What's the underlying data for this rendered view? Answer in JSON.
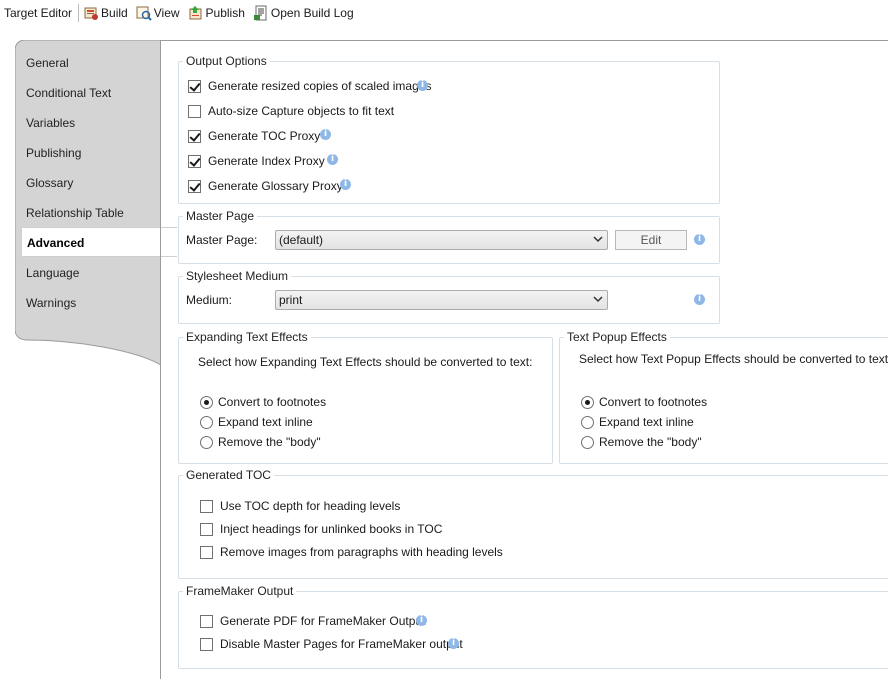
{
  "toolbar": {
    "title": "Target Editor",
    "build_label": "Build",
    "view_label": "View",
    "publish_label": "Publish",
    "open_log_label": "Open Build Log"
  },
  "sidebar": {
    "items": [
      {
        "label": "General"
      },
      {
        "label": "Conditional Text"
      },
      {
        "label": "Variables"
      },
      {
        "label": "Publishing"
      },
      {
        "label": "Glossary"
      },
      {
        "label": "Relationship Table"
      },
      {
        "label": "Advanced",
        "active": true
      },
      {
        "label": "Language"
      },
      {
        "label": "Warnings"
      }
    ]
  },
  "output_options": {
    "title": "Output Options",
    "items": [
      {
        "label": "Generate resized copies of scaled images",
        "checked": true
      },
      {
        "label": "Auto-size Capture objects to fit text",
        "checked": false
      },
      {
        "label": "Generate TOC Proxy",
        "checked": true
      },
      {
        "label": "Generate Index Proxy",
        "checked": true
      },
      {
        "label": "Generate Glossary Proxy",
        "checked": true
      }
    ]
  },
  "master_page": {
    "title": "Master Page",
    "label": "Master Page:",
    "value": "(default)",
    "edit_label": "Edit"
  },
  "stylesheet_medium": {
    "title": "Stylesheet Medium",
    "label": "Medium:",
    "value": "print"
  },
  "expanding_text_effects": {
    "title": "Expanding Text Effects",
    "description": "Select how Expanding Text Effects should be converted to text:",
    "options": [
      {
        "label": "Convert to footnotes",
        "selected": true
      },
      {
        "label": "Expand text inline",
        "selected": false
      },
      {
        "label": "Remove the \"body\"",
        "selected": false
      }
    ]
  },
  "text_popup_effects": {
    "title": "Text Popup Effects",
    "description": "Select how Text Popup Effects should be converted to text:",
    "options": [
      {
        "label": "Convert to footnotes",
        "selected": true
      },
      {
        "label": "Expand text inline",
        "selected": false
      },
      {
        "label": "Remove the \"body\"",
        "selected": false
      }
    ]
  },
  "generated_toc": {
    "title": "Generated TOC",
    "items": [
      {
        "label": "Use TOC depth for heading levels",
        "checked": false
      },
      {
        "label": "Inject headings for unlinked books in TOC",
        "checked": false
      },
      {
        "label": "Remove images from paragraphs with heading levels",
        "checked": false
      }
    ]
  },
  "framemaker_output": {
    "title": "FrameMaker Output",
    "items": [
      {
        "label": "Generate PDF for FrameMaker Output",
        "checked": false
      },
      {
        "label": "Disable Master Pages for FrameMaker output",
        "checked": false
      }
    ]
  },
  "colors": {
    "panel_gray": "#d4d4d4",
    "info_blue": "#8fb8e6",
    "group_border": "#d5dfe5"
  }
}
